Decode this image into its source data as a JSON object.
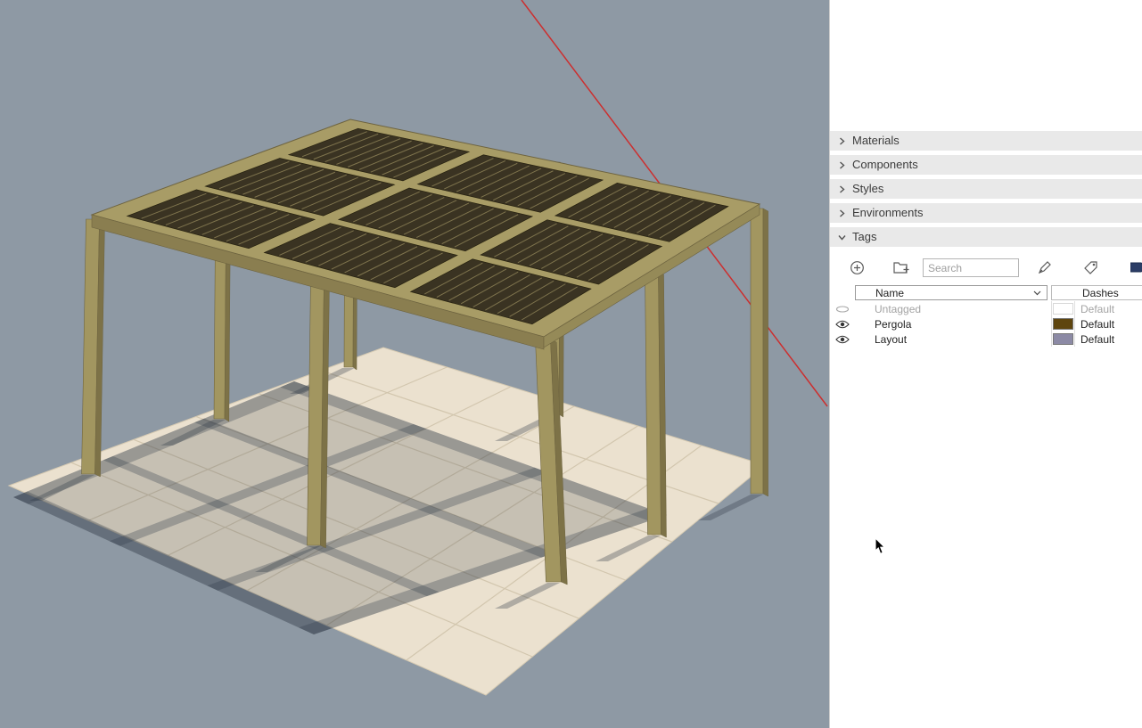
{
  "viewport": {
    "background": "#8e99a4",
    "axis_color": "#cc2f2f",
    "wood_color": "#a89c66",
    "wood_dark": "#8a7e50",
    "panel_dark": "#3a3322",
    "floor_color": "#ebe1cf",
    "model_name": "pergola"
  },
  "tray": {
    "sections": [
      {
        "label": "Materials",
        "expanded": false
      },
      {
        "label": "Components",
        "expanded": false
      },
      {
        "label": "Styles",
        "expanded": false
      },
      {
        "label": "Environments",
        "expanded": false
      },
      {
        "label": "Tags",
        "expanded": true
      }
    ],
    "tags": {
      "search_placeholder": "Search",
      "columns": {
        "name": "Name",
        "dashes": "Dashes"
      },
      "rows": [
        {
          "name": "Untagged",
          "visible": false,
          "color": "",
          "dashes": "Default",
          "muted": true
        },
        {
          "name": "Pergola",
          "visible": true,
          "color": "#5e450e",
          "dashes": "Default",
          "muted": false
        },
        {
          "name": "Layout",
          "visible": true,
          "color": "#8c8aa5",
          "dashes": "Default",
          "muted": false
        }
      ]
    }
  }
}
